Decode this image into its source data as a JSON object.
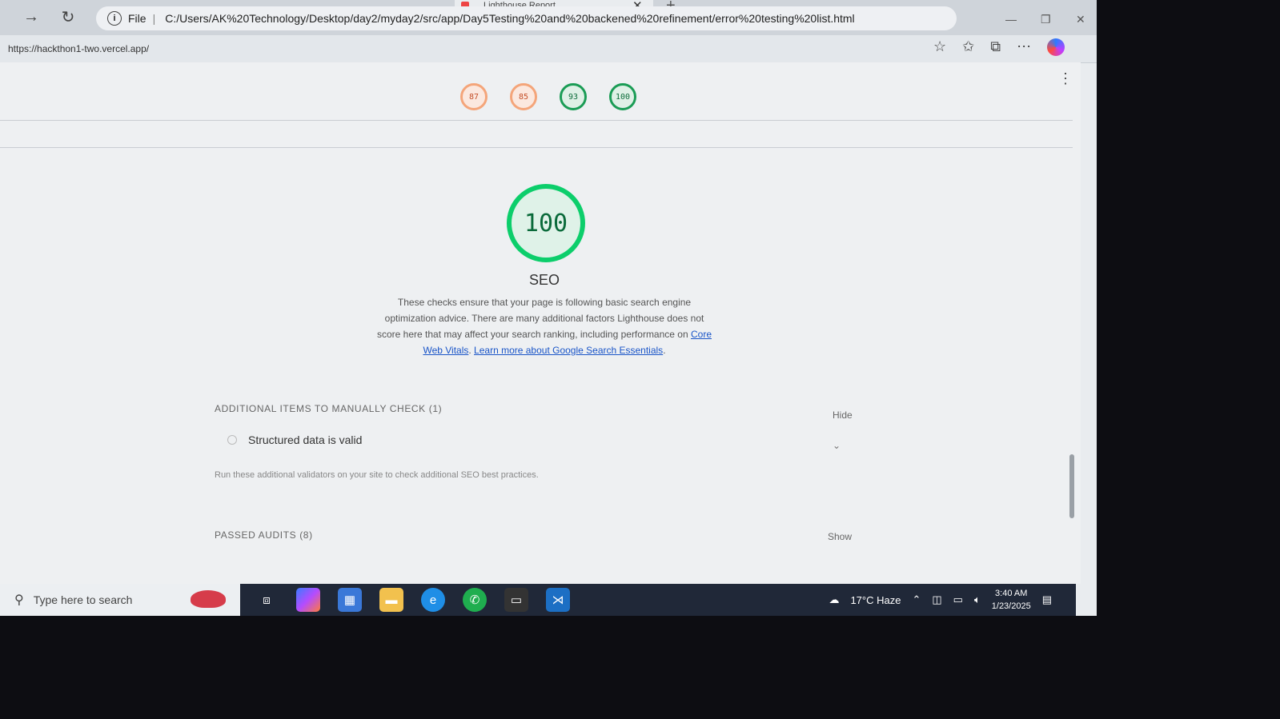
{
  "browser": {
    "tab_title": "Lighthouse Report",
    "address": "C:/Users/AK%20Technology/Desktop/day2/myday2/src/app/Day5Testing%20and%20backened%20refinement/error%20testing%20list.html",
    "address_scheme": "File",
    "page_url": "https://hackthon1-two.vercel.app/"
  },
  "scores": [
    {
      "value": "87",
      "status": "orange"
    },
    {
      "value": "85",
      "status": "orange"
    },
    {
      "value": "93",
      "status": "green"
    },
    {
      "value": "100",
      "status": "green"
    }
  ],
  "seo": {
    "score": "100",
    "title": "SEO",
    "desc_part1": "These checks ensure that your page is following basic search engine optimization advice. There are many additional factors Lighthouse does not score here that may affect your search ranking, including performance on ",
    "link1": "Core Web Vitals",
    "desc_part2": ". ",
    "link2": "Learn more about Google Search Essentials",
    "desc_part3": "."
  },
  "manual_check": {
    "header": "ADDITIONAL ITEMS TO MANUALLY CHECK (1)",
    "toggle": "Hide",
    "item": "Structured data is valid",
    "note": "Run these additional validators on your site to check additional SEO best practices."
  },
  "passed_audits": {
    "header": "PASSED AUDITS (8)",
    "toggle": "Show"
  },
  "taskbar": {
    "search_placeholder": "Type here to search",
    "weather": "17°C  Haze",
    "time": "3:40 AM",
    "date": "1/23/2025"
  },
  "colors": {
    "score_green": "#0cce6b",
    "score_orange": "#ffa400",
    "link": "#1a55c8"
  }
}
